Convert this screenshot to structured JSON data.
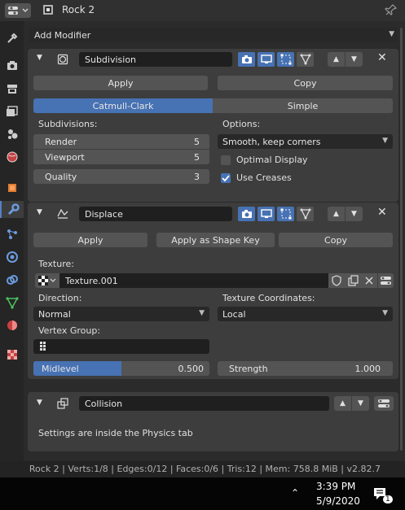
{
  "header": {
    "object_name": "Rock 2"
  },
  "add_modifier": {
    "label": "Add Modifier"
  },
  "subdivision": {
    "name": "Subdivision",
    "apply": "Apply",
    "copy": "Copy",
    "tabs": [
      "Catmull-Clark",
      "Simple"
    ],
    "subdivisions_label": "Subdivisions:",
    "render_label": "Render",
    "render_value": "5",
    "viewport_label": "Viewport",
    "viewport_value": "5",
    "quality_label": "Quality",
    "quality_value": "3",
    "options_label": "Options:",
    "options_value": "Smooth, keep corners",
    "optimal_display": "Optimal Display",
    "optimal_display_checked": false,
    "use_creases": "Use Creases",
    "use_creases_checked": true
  },
  "displace": {
    "name": "Displace",
    "apply": "Apply",
    "apply_shape_key": "Apply as Shape Key",
    "copy": "Copy",
    "texture_label": "Texture:",
    "texture_value": "Texture.001",
    "direction_label": "Direction:",
    "direction_value": "Normal",
    "tex_coords_label": "Texture Coordinates:",
    "tex_coords_value": "Local",
    "vertex_group_label": "Vertex Group:",
    "vertex_group_value": "",
    "midlevel_label": "Midlevel",
    "midlevel_value": "0.500",
    "midlevel_fraction": 0.5,
    "strength_label": "Strength",
    "strength_value": "1.000"
  },
  "collision": {
    "name": "Collision",
    "info": "Settings are inside the Physics tab"
  },
  "status": {
    "text": "Rock 2 | Verts:1/8 | Edges:0/12 | Faces:0/6 | Tris:12 | Mem: 758.8 MiB | v2.82.7"
  },
  "taskbar": {
    "time": "3:39 PM",
    "date": "5/9/2020"
  },
  "colors": {
    "accent": "#4772b3",
    "panel": "#3d3d3d",
    "button": "#545454"
  }
}
